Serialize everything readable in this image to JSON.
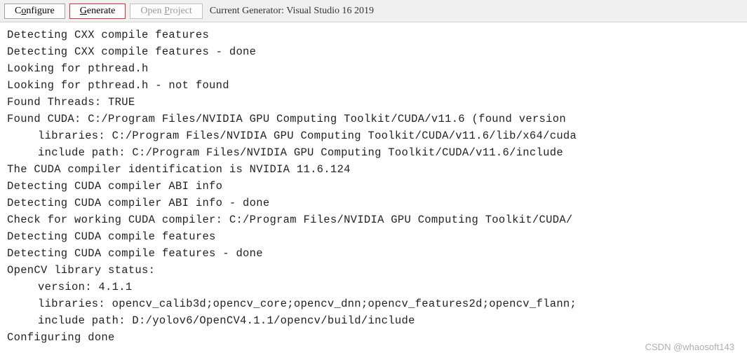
{
  "toolbar": {
    "configure_pre": "C",
    "configure_ul": "o",
    "configure_post": "nfigure",
    "generate_pre": "",
    "generate_ul": "G",
    "generate_post": "enerate",
    "openproj_pre": "Open ",
    "openproj_ul": "P",
    "openproj_post": "roject",
    "current_generator": "Current Generator: Visual Studio 16 2019"
  },
  "log": {
    "lines": [
      "Detecting CXX compile features",
      "Detecting CXX compile features - done",
      "Looking for pthread.h",
      "Looking for pthread.h - not found",
      "Found Threads: TRUE",
      "Found CUDA: C:/Program Files/NVIDIA GPU Computing Toolkit/CUDA/v11.6 (found version"
    ],
    "indent1": "libraries: C:/Program Files/NVIDIA GPU Computing Toolkit/CUDA/v11.6/lib/x64/cuda",
    "indent2": "include path: C:/Program Files/NVIDIA GPU Computing Toolkit/CUDA/v11.6/include",
    "lines2": [
      "The CUDA compiler identification is NVIDIA 11.6.124",
      "Detecting CUDA compiler ABI info",
      "Detecting CUDA compiler ABI info - done",
      "Check for working CUDA compiler: C:/Program Files/NVIDIA GPU Computing Toolkit/CUDA/",
      "Detecting CUDA compile features",
      "Detecting CUDA compile features - done",
      "OpenCV library status:"
    ],
    "indent3": "version: 4.1.1",
    "indent4": "libraries: opencv_calib3d;opencv_core;opencv_dnn;opencv_features2d;opencv_flann;",
    "indent5": "include path: D:/yolov6/OpenCV4.1.1/opencv/build/include",
    "final": "Configuring done"
  },
  "watermark": "CSDN @whaosoft143"
}
